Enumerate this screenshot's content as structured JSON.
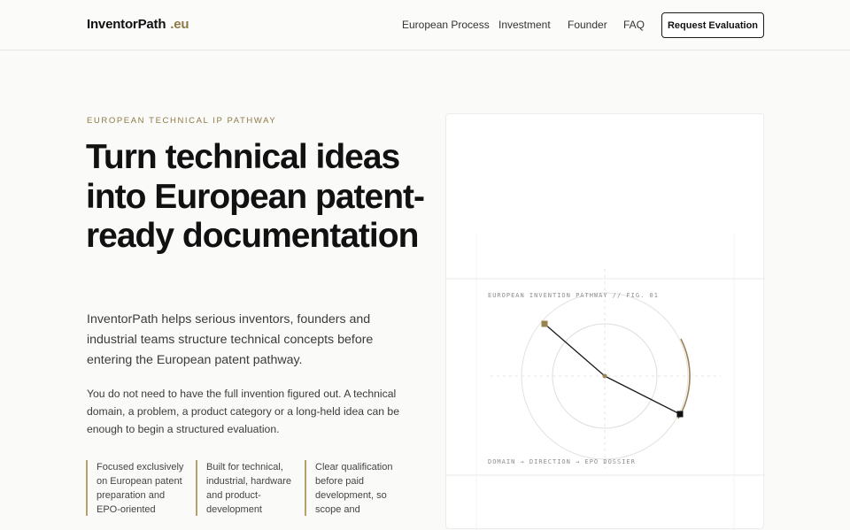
{
  "header": {
    "logo_main": "InventorPath",
    "logo_tld": ".eu",
    "nav": [
      "European Process",
      "Investment",
      "Founder",
      "FAQ"
    ],
    "cta_label": "Request Evaluation"
  },
  "hero": {
    "eyebrow": "EUROPEAN TECHNICAL IP PATHWAY",
    "title": "Turn technical ideas into European patent-ready documentation",
    "lead": "InventorPath helps serious inventors, founders and industrial teams structure technical concepts before entering the European patent pathway.",
    "body": "You do not need to have the full invention figured out. A technical domain, a problem, a product category or a long-held idea can be enough to begin a structured evaluation.",
    "features": [
      "Focused exclusively on European patent preparation and EPO-oriented",
      "Built for technical, industrial, hardware and product-development",
      "Clear qualification before paid development, so scope and"
    ]
  },
  "figure": {
    "label_top": "EUROPEAN INVENTION PATHWAY // FIG. 01",
    "label_bottom": "DOMAIN → DIRECTION → EPO DOSSIER",
    "accent_color": "#9a8352"
  }
}
